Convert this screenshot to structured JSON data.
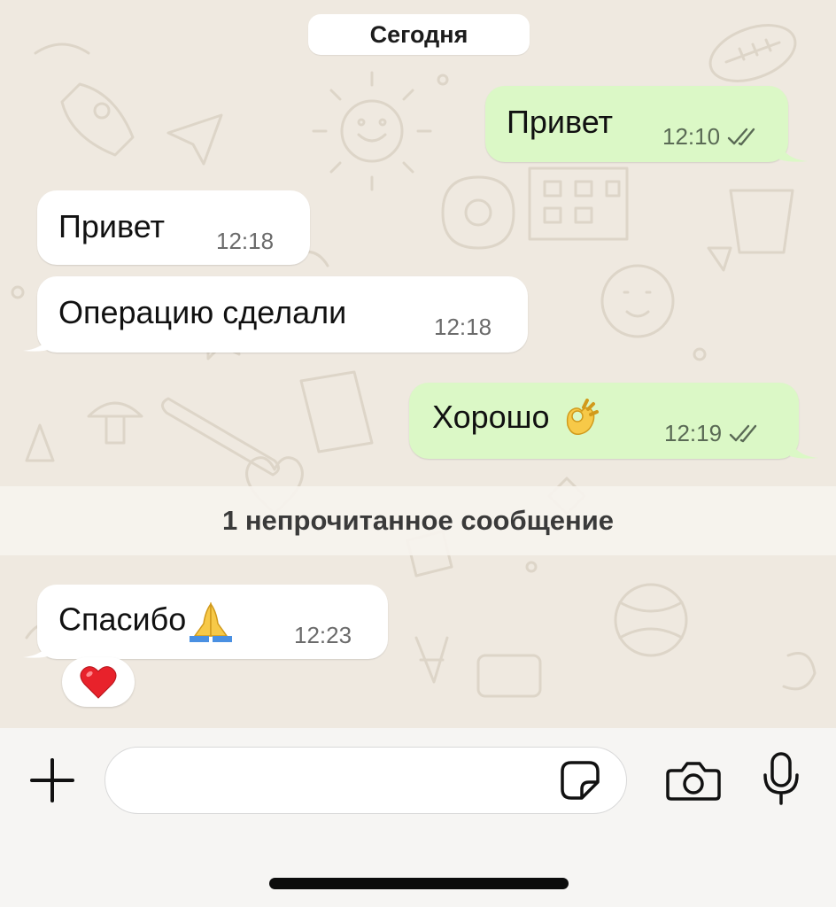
{
  "date_separator": "Сегодня",
  "messages": [
    {
      "direction": "outgoing",
      "text": "Привет",
      "time": "12:10",
      "status": "read"
    },
    {
      "direction": "incoming",
      "text": "Привет",
      "time": "12:18"
    },
    {
      "direction": "incoming",
      "text": "Операцию сделали",
      "time": "12:18"
    },
    {
      "direction": "outgoing",
      "text": "Хорошо",
      "emoji": "ok-hand",
      "time": "12:19",
      "status": "read"
    },
    {
      "direction": "incoming",
      "text": "Спасибо",
      "emoji": "folded-hands",
      "time": "12:23",
      "reaction": "red-heart"
    }
  ],
  "unread_divider": "1 непрочитанное сообщение",
  "composer": {
    "placeholder": "",
    "value": "",
    "icons": [
      "plus-icon",
      "sticker-icon",
      "camera-icon",
      "microphone-icon"
    ]
  },
  "colors": {
    "outgoing_bubble": "#dbf8c6",
    "incoming_bubble": "#ffffff",
    "chat_background": "#efe9e0",
    "read_ticks": "#5a6a55"
  }
}
